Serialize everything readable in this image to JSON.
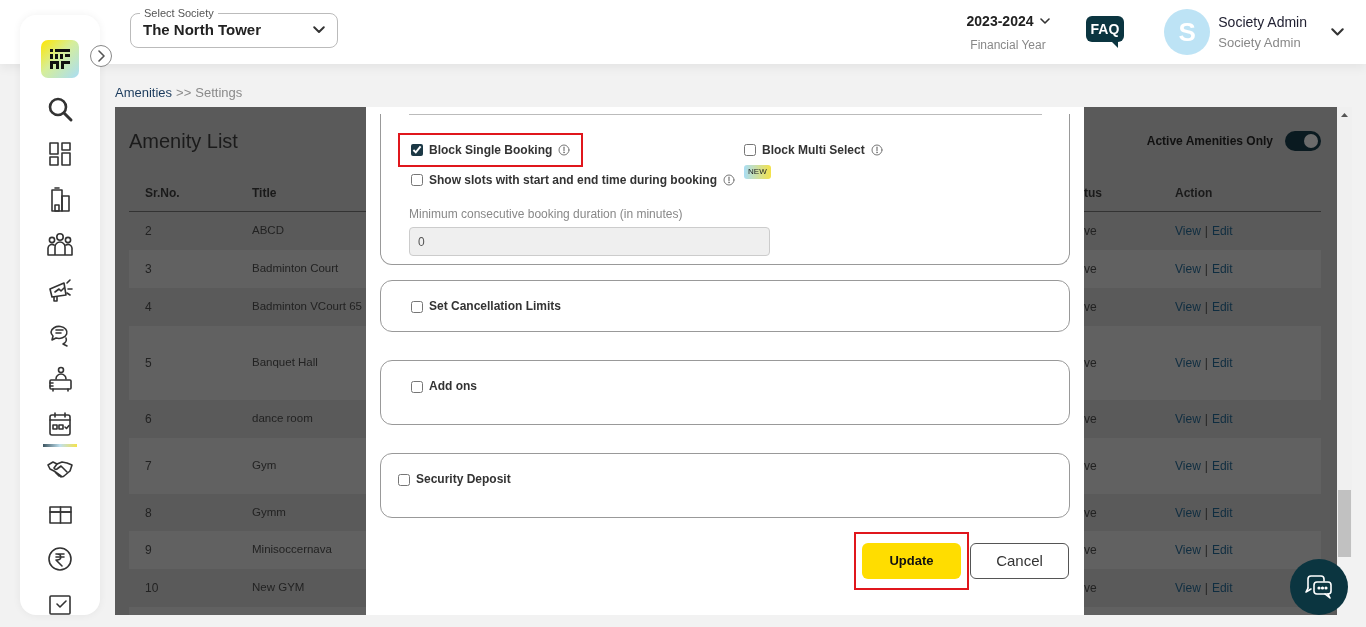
{
  "header": {
    "society_select": {
      "label": "Select Society",
      "value": "The North Tower"
    },
    "financial_year": {
      "value": "2023-2024",
      "label": "Financial Year"
    },
    "faq": "FAQ",
    "user": {
      "initial": "S",
      "name": "Society Admin",
      "role": "Society Admin"
    }
  },
  "sidebar": {
    "items": [
      {
        "selected": false
      },
      {
        "selected": false
      },
      {
        "selected": false
      },
      {
        "selected": false
      },
      {
        "selected": false
      },
      {
        "selected": false
      },
      {
        "selected": false
      },
      {
        "selected": true
      },
      {
        "selected": false
      },
      {
        "selected": false
      },
      {
        "selected": false
      }
    ]
  },
  "breadcrumb": {
    "items": [
      "Amenities",
      "Settings"
    ],
    "separator": ">>"
  },
  "amenity_list": {
    "title": "Amenity List",
    "filter": {
      "label": "Active Amenities Only",
      "on": true
    },
    "columns": [
      "Sr.No.",
      "Title",
      "tus",
      "Action"
    ],
    "rows": [
      {
        "sr": "2",
        "title": "ABCD",
        "status": "ve",
        "actions": [
          "View",
          "Edit"
        ],
        "separator": "|"
      },
      {
        "sr": "3",
        "title": "Badminton Court",
        "status": "ve",
        "actions": [
          "View",
          "Edit"
        ],
        "separator": "|"
      },
      {
        "sr": "4",
        "title": "Badminton VCourt 65",
        "status": "ve",
        "actions": [
          "View",
          "Edit"
        ],
        "separator": "|"
      },
      {
        "sr": "5",
        "title": "Banquet Hall",
        "status": "ve",
        "actions": [
          "View",
          "Edit"
        ],
        "separator": "|"
      },
      {
        "sr": "6",
        "title": "dance room",
        "status": "ve",
        "actions": [
          "View",
          "Edit"
        ],
        "separator": "|"
      },
      {
        "sr": "7",
        "title": "Gym",
        "status": "ve",
        "actions": [
          "View",
          "Edit"
        ],
        "separator": "|"
      },
      {
        "sr": "8",
        "title": "Gymm",
        "status": "ve",
        "actions": [
          "View",
          "Edit"
        ],
        "separator": "|"
      },
      {
        "sr": "9",
        "title": "Minisoccernava",
        "status": "ve",
        "actions": [
          "View",
          "Edit"
        ],
        "separator": "|"
      },
      {
        "sr": "10",
        "title": "New GYM",
        "status": "ve",
        "actions": [
          "View",
          "Edit"
        ],
        "separator": "|"
      }
    ]
  },
  "modal": {
    "booking_options": [
      {
        "label": "Block Single Booking",
        "checked": true,
        "highlighted": true
      },
      {
        "label": "Block Multi Select",
        "checked": false,
        "highlighted": false
      },
      {
        "label": "Show slots with start and end time during booking",
        "checked": false,
        "highlighted": false,
        "badge": "NEW"
      }
    ],
    "duration": {
      "label": "Minimum consecutive booking duration (in minutes)",
      "value": "0",
      "disabled": true
    },
    "sections": [
      {
        "label": "Set Cancellation Limits",
        "checked": false
      },
      {
        "label": "Add ons",
        "checked": false
      },
      {
        "label": "Security Deposit",
        "checked": false
      }
    ],
    "buttons": [
      {
        "label": "Update",
        "kind": "primary",
        "highlighted": true
      },
      {
        "label": "Cancel",
        "kind": "secondary",
        "highlighted": false
      }
    ]
  }
}
